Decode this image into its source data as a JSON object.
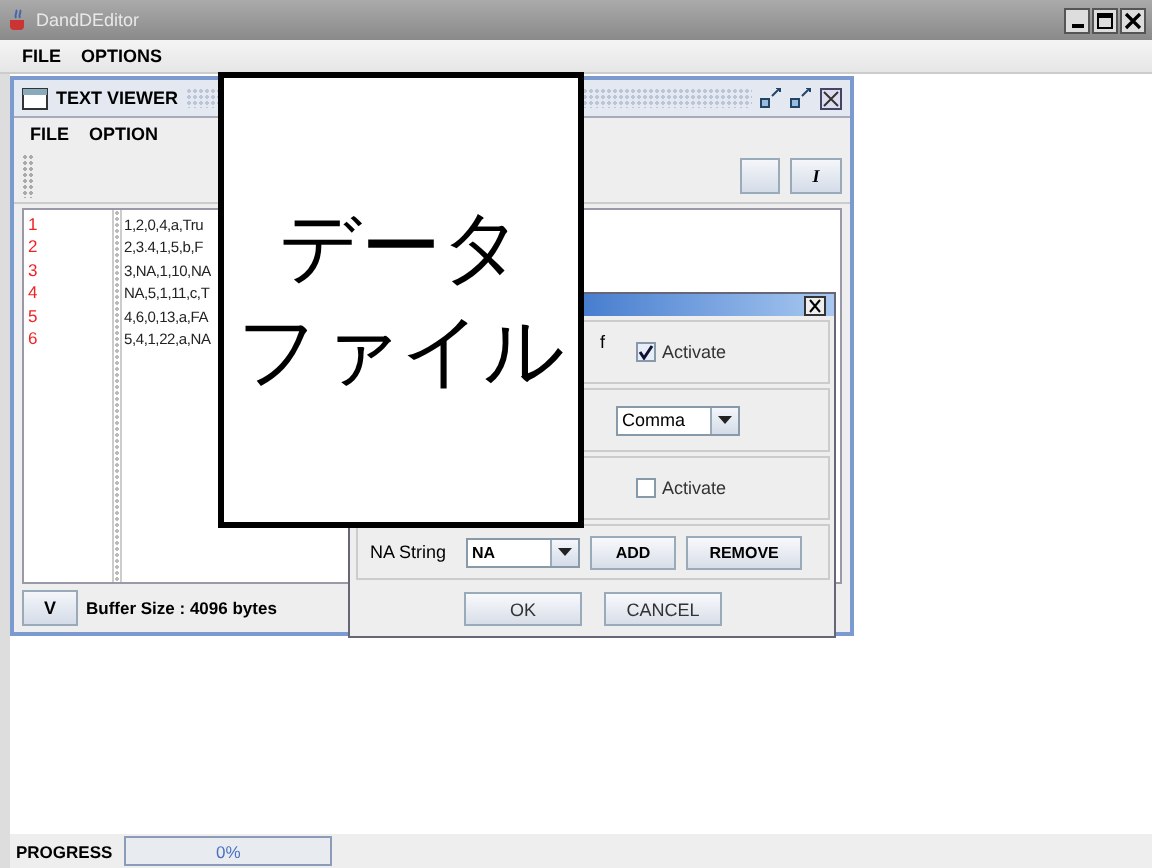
{
  "window": {
    "title": "DandDEditor",
    "menu": [
      "FILE",
      "OPTIONS"
    ]
  },
  "text_viewer": {
    "title": "TEXT VIEWER",
    "menu": [
      "FILE",
      "OPTION"
    ],
    "toolbar_button": "I",
    "line_numbers": [
      "1",
      "2",
      "3",
      "4",
      "5",
      "6"
    ],
    "lines": [
      "1,2,0,4,a,Tru",
      "2,3.4,1,5,b,F",
      "3,NA,1,10,NA",
      "NA,5,1,11,c,T",
      "4,6,0,13,a,FA",
      "5,4,1,22,a,NA"
    ],
    "footer_button": "V",
    "buffer_size": "Buffer Size : 4096 bytes"
  },
  "dialog": {
    "rows": [
      {
        "kind": "checkbox",
        "label": "f",
        "option": "Activate",
        "checked": true
      },
      {
        "kind": "dropdown",
        "value": "Comma"
      },
      {
        "kind": "checkbox",
        "option": "Activate",
        "checked": false
      },
      {
        "kind": "na",
        "label": "NA String",
        "value": "NA",
        "buttons": [
          "ADD",
          "REMOVE"
        ]
      }
    ],
    "buttons": [
      "OK",
      "CANCEL"
    ]
  },
  "callout": {
    "lines": [
      "データ",
      "ファイル"
    ]
  },
  "progress": {
    "label": "PROGRESS",
    "level": 0,
    "reading": "0%"
  }
}
